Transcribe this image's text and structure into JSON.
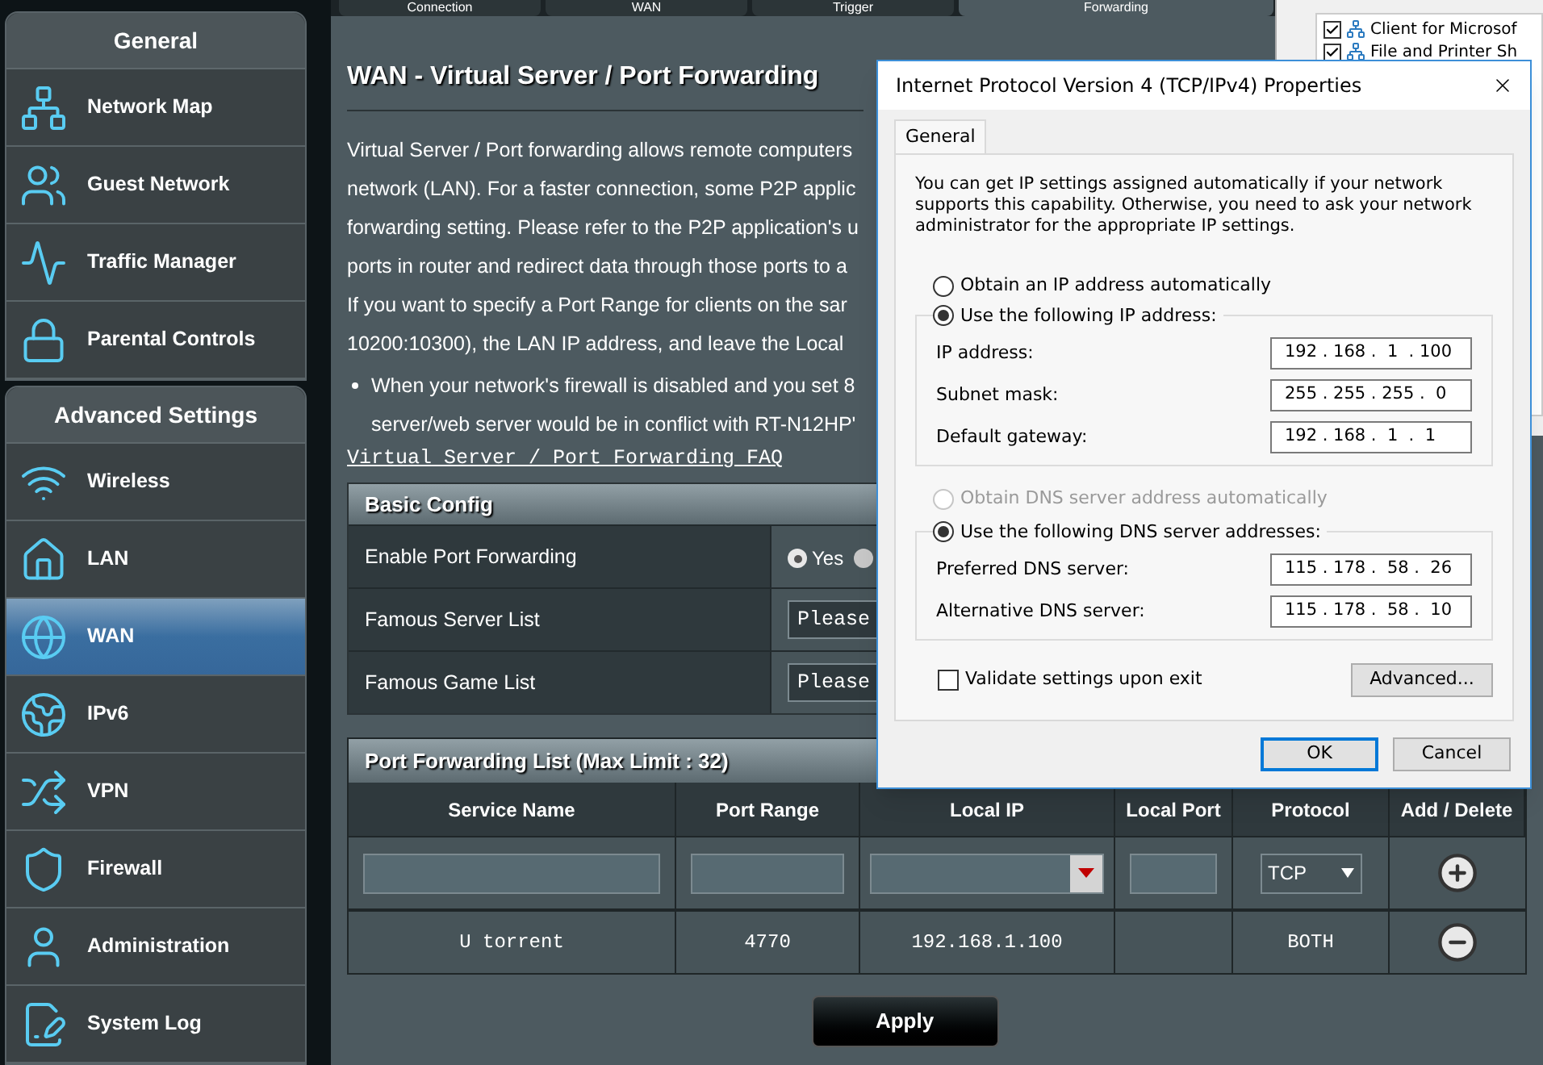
{
  "top_tabs": [
    {
      "label": "Connection",
      "selected": false
    },
    {
      "label": "WAN",
      "selected": false
    },
    {
      "label": "Trigger",
      "selected": false
    },
    {
      "label": "Forwarding",
      "selected": true
    }
  ],
  "sidebar": [
    {
      "title": "General",
      "items": [
        {
          "label": "Network Map",
          "selected": false
        },
        {
          "label": "Guest Network",
          "selected": false
        },
        {
          "label": "Traffic Manager",
          "selected": false
        },
        {
          "label": "Parental Controls",
          "selected": false
        }
      ]
    },
    {
      "title": "Advanced Settings",
      "items": [
        {
          "label": "Wireless",
          "selected": false
        },
        {
          "label": "LAN",
          "selected": false
        },
        {
          "label": "WAN",
          "selected": true
        },
        {
          "label": "IPv6",
          "selected": false
        },
        {
          "label": "VPN",
          "selected": false
        },
        {
          "label": "Firewall",
          "selected": false
        },
        {
          "label": "Administration",
          "selected": false
        },
        {
          "label": "System Log",
          "selected": false
        }
      ]
    }
  ],
  "page": {
    "title": "WAN - Virtual Server / Port Forwarding",
    "description_lines": [
      "Virtual Server / Port forwarding allows remote computers",
      "network (LAN). For a faster connection, some P2P applic",
      "forwarding setting. Please refer to the P2P application's u",
      "ports in router and redirect data through those ports to a",
      "If you want to specify a Port Range for clients on the sar",
      "10200:10300), the LAN IP address, and leave the Local"
    ],
    "bullet_lines": [
      "When your network's firewall is disabled and you set 8",
      "server/web server would be in conflict with RT-N12HP'"
    ],
    "faq_link": "Virtual Server / Port Forwarding FAQ"
  },
  "basic_config": {
    "title": "Basic Config",
    "rows": [
      {
        "kind": "radio",
        "label": "Enable Port Forwarding",
        "options": [
          {
            "label": "Yes",
            "selected": true
          },
          {
            "selected": false
          }
        ]
      },
      {
        "kind": "select",
        "label": "Famous Server List",
        "value": "Please"
      },
      {
        "kind": "select",
        "label": "Famous Game List",
        "value": "Please"
      }
    ]
  },
  "port_forwarding": {
    "title": "Port Forwarding List (Max Limit : 32)",
    "columns": [
      "Service Name",
      "Port Range",
      "Local IP",
      "Local Port",
      "Protocol",
      "Add / Delete"
    ],
    "input_row": {
      "protocol": "TCP"
    },
    "rows": [
      {
        "service_name": "U torrent",
        "port_range": "4770",
        "local_ip": "192.168.1.100",
        "protocol": "BOTH"
      }
    ]
  },
  "apply_button": "Apply",
  "background_window": {
    "items": [
      {
        "label": "Client for Microsof",
        "checked": true
      },
      {
        "label": "File and Printer Sh",
        "checked": true
      }
    ]
  },
  "dialog": {
    "title": "Internet Protocol Version 4 (TCP/IPv4) Properties",
    "tabs": [
      {
        "label": "General",
        "selected": true
      }
    ],
    "intro": "You can get IP settings assigned automatically if your network supports this capability. Otherwise, you need to ask your network administrator for the appropriate IP settings.",
    "ip_auto": {
      "label": "Obtain an IP address automatically",
      "selected": false,
      "disabled": false
    },
    "ip_manual": {
      "label": "Use the following IP address:",
      "selected": true,
      "disabled": false
    },
    "ip_fields": [
      {
        "label": "IP address:",
        "value": "192 . 168 .  1  . 100"
      },
      {
        "label": "Subnet mask:",
        "value": "255 . 255 . 255 .  0"
      },
      {
        "label": "Default gateway:",
        "value": "192 . 168 .  1  .  1"
      }
    ],
    "dns_auto": {
      "label": "Obtain DNS server address automatically",
      "selected": false,
      "disabled": true
    },
    "dns_manual": {
      "label": "Use the following DNS server addresses:",
      "selected": true,
      "disabled": false
    },
    "dns_fields": [
      {
        "label": "Preferred DNS server:",
        "value": "115 . 178 .  58 .  26"
      },
      {
        "label": "Alternative DNS server:",
        "value": "115 . 178 .  58 .  10"
      }
    ],
    "validate": {
      "label": "Validate settings upon exit",
      "checked": false
    },
    "advanced_button": "Advanced...",
    "buttons": [
      {
        "label": "OK",
        "default": true
      },
      {
        "label": "Cancel",
        "default": false
      }
    ]
  }
}
